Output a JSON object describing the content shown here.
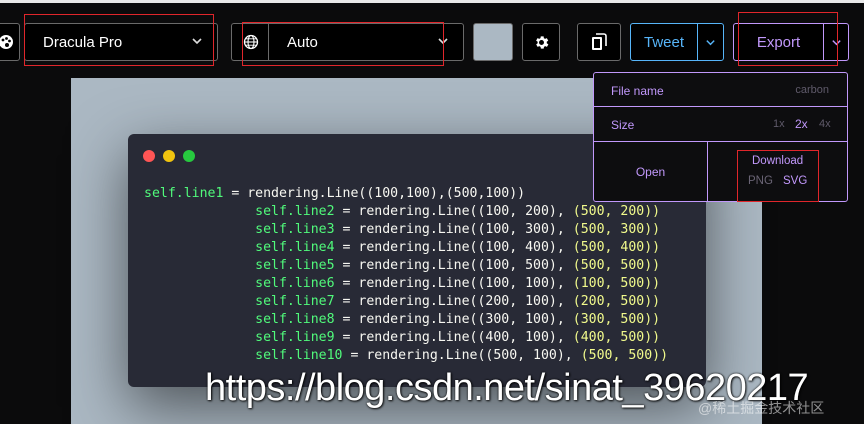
{
  "toolbar": {
    "theme": {
      "icon": "palette-icon",
      "value": "Dracula Pro"
    },
    "language": {
      "icon": "globe-icon",
      "value": "Auto"
    },
    "background_color": "#abb8c3",
    "settings_icon": "gear-icon",
    "copy_icon": "clipboard-icon",
    "tweet_label": "Tweet",
    "export_label": "Export"
  },
  "export_menu": {
    "file_name_label": "File name",
    "file_name_placeholder": "carbon",
    "size_label": "Size",
    "sizes": [
      "1x",
      "2x",
      "4x"
    ],
    "size_selected": "2x",
    "open_label": "Open",
    "download_label": "Download",
    "formats": [
      "PNG",
      "SVG"
    ]
  },
  "code": {
    "lines": [
      {
        "indent": "",
        "var": "self.line1",
        "pre": " = rendering.Line((100,100),(500,100))",
        "tuple": ""
      },
      {
        "indent": "              ",
        "var": "self.line2",
        "pre": " = rendering.Line((100, 200), ",
        "tuple": "(500, 200))"
      },
      {
        "indent": "              ",
        "var": "self.line3",
        "pre": " = rendering.Line((100, 300), ",
        "tuple": "(500, 300))"
      },
      {
        "indent": "              ",
        "var": "self.line4",
        "pre": " = rendering.Line((100, 400), ",
        "tuple": "(500, 400))"
      },
      {
        "indent": "              ",
        "var": "self.line5",
        "pre": " = rendering.Line((100, 500), ",
        "tuple": "(500, 500))"
      },
      {
        "indent": "              ",
        "var": "self.line6",
        "pre": " = rendering.Line((100, 100), ",
        "tuple": "(100, 500))"
      },
      {
        "indent": "              ",
        "var": "self.line7",
        "pre": " = rendering.Line((200, 100), ",
        "tuple": "(200, 500))"
      },
      {
        "indent": "              ",
        "var": "self.line8",
        "pre": " = rendering.Line((300, 100), ",
        "tuple": "(300, 500))"
      },
      {
        "indent": "              ",
        "var": "self.line9",
        "pre": " = rendering.Line((400, 100), ",
        "tuple": "(400, 500))"
      },
      {
        "indent": "              ",
        "var": "self.line10",
        "pre": " = rendering.Line((500, 100), ",
        "tuple": "(500, 500))"
      }
    ]
  },
  "window_dots": {
    "red": "#ff5555",
    "yellow": "#f1c40f",
    "green": "#27c93f"
  },
  "watermark": {
    "url": "https://blog.csdn.net/sinat_39620217",
    "community": "@稀土掘金技术社区"
  }
}
